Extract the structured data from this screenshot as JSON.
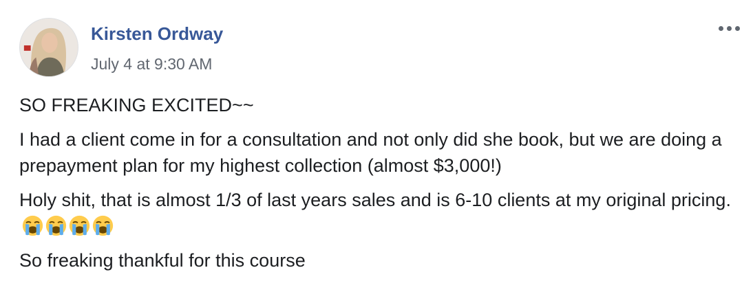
{
  "post": {
    "author": "Kirsten Ordway",
    "timestamp": "July 4 at 9:30 AM",
    "more_icon": "more-options-icon",
    "avatar_icon": "profile-photo",
    "paragraphs": [
      "SO FREAKING EXCITED~~",
      "I had a client come in for a consultation and not only did she book, but we are doing a prepayment plan for my highest collection (almost $3,000!)",
      "Holy shit, that is almost 1/3 of last years sales and is 6-10 clients at my original pricing.",
      "So freaking thankful for this course"
    ],
    "emoji": [
      "loudly-crying-face",
      "loudly-crying-face",
      "loudly-crying-face",
      "loudly-crying-face"
    ],
    "colors": {
      "author": "#385898",
      "timestamp": "#616770",
      "text": "#1c1e21",
      "emoji_face": "#ffcc4d",
      "emoji_tears": "#5dadec"
    }
  }
}
